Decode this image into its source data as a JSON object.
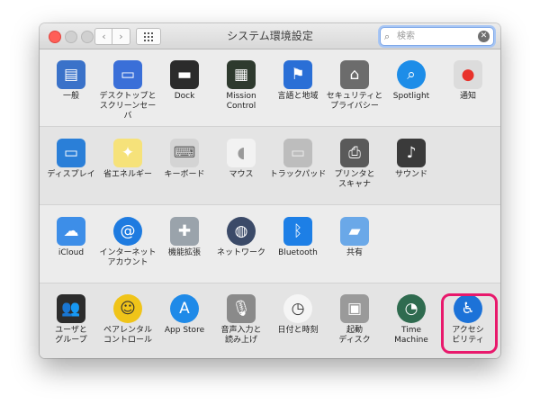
{
  "window": {
    "title": "システム環境設定"
  },
  "toolbar": {
    "back": "‹",
    "forward": "›"
  },
  "search": {
    "placeholder": "検索",
    "icon": "search-icon"
  },
  "sections": [
    {
      "items": [
        {
          "label": "一般",
          "icon": "general-file-icon",
          "color": "#3a72c9"
        },
        {
          "label": "デスクトップと\nスクリーンセーバ",
          "icon": "desktop-screensaver-icon",
          "color": "#3a6fd8"
        },
        {
          "label": "Dock",
          "icon": "dock-icon",
          "color": "#2b2b2b"
        },
        {
          "label": "Mission\nControl",
          "icon": "mission-control-icon",
          "color": "#2e3a2e"
        },
        {
          "label": "言語と地域",
          "icon": "flag-globe-icon",
          "color": "#2a6fd6"
        },
        {
          "label": "セキュリティと\nプライバシー",
          "icon": "security-house-icon",
          "color": "#6c6c6c"
        },
        {
          "label": "Spotlight",
          "icon": "spotlight-magnifier-icon",
          "color": "#1d8de8"
        },
        {
          "label": "通知",
          "icon": "notifications-icon",
          "color": "#dcdcdc"
        }
      ]
    },
    {
      "items": [
        {
          "label": "ディスプレイ",
          "icon": "display-icon",
          "color": "#2a7fd8"
        },
        {
          "label": "省エネルギー",
          "icon": "lightbulb-icon",
          "color": "#f6e27a"
        },
        {
          "label": "キーボード",
          "icon": "keyboard-icon",
          "color": "#d4d4d4"
        },
        {
          "label": "マウス",
          "icon": "mouse-icon",
          "color": "#f2f2f2"
        },
        {
          "label": "トラックパッド",
          "icon": "trackpad-icon",
          "color": "#bdbdbd"
        },
        {
          "label": "プリンタと\nスキャナ",
          "icon": "printer-icon",
          "color": "#5a5a5a"
        },
        {
          "label": "サウンド",
          "icon": "speaker-icon",
          "color": "#3a3a3a"
        }
      ]
    },
    {
      "items": [
        {
          "label": "iCloud",
          "icon": "icloud-icon",
          "color": "#3d8ee8"
        },
        {
          "label": "インターネット\nアカウント",
          "icon": "at-sign-icon",
          "color": "#1e7be0"
        },
        {
          "label": "機能拡張",
          "icon": "puzzle-piece-icon",
          "color": "#9aa3ab"
        },
        {
          "label": "ネットワーク",
          "icon": "network-globe-icon",
          "color": "#3b4a68"
        },
        {
          "label": "Bluetooth",
          "icon": "bluetooth-icon",
          "color": "#1d7fe6"
        },
        {
          "label": "共有",
          "icon": "sharing-folder-icon",
          "color": "#6aa8e8"
        }
      ]
    },
    {
      "items": [
        {
          "label": "ユーザと\nグループ",
          "icon": "users-groups-icon",
          "color": "#2c2c2c"
        },
        {
          "label": "ペアレンタル\nコントロール",
          "icon": "parental-controls-icon",
          "color": "#f0c419"
        },
        {
          "label": "App Store",
          "icon": "app-store-icon",
          "color": "#1f8ae8"
        },
        {
          "label": "音声入力と\n読み上げ",
          "icon": "microphone-icon",
          "color": "#8a8a8a"
        },
        {
          "label": "日付と時刻",
          "icon": "clock-calendar-icon",
          "color": "#f5f5f5"
        },
        {
          "label": "起動\nディスク",
          "icon": "startup-disk-icon",
          "color": "#9a9a9a"
        },
        {
          "label": "Time\nMachine",
          "icon": "time-machine-icon",
          "color": "#2f6b4f"
        },
        {
          "label": "アクセシ\nビリティ",
          "icon": "accessibility-icon",
          "color": "#1c72d8"
        }
      ]
    }
  ],
  "highlight": {
    "target": "アクセシ\nビリティ",
    "color": "#e8196c"
  }
}
